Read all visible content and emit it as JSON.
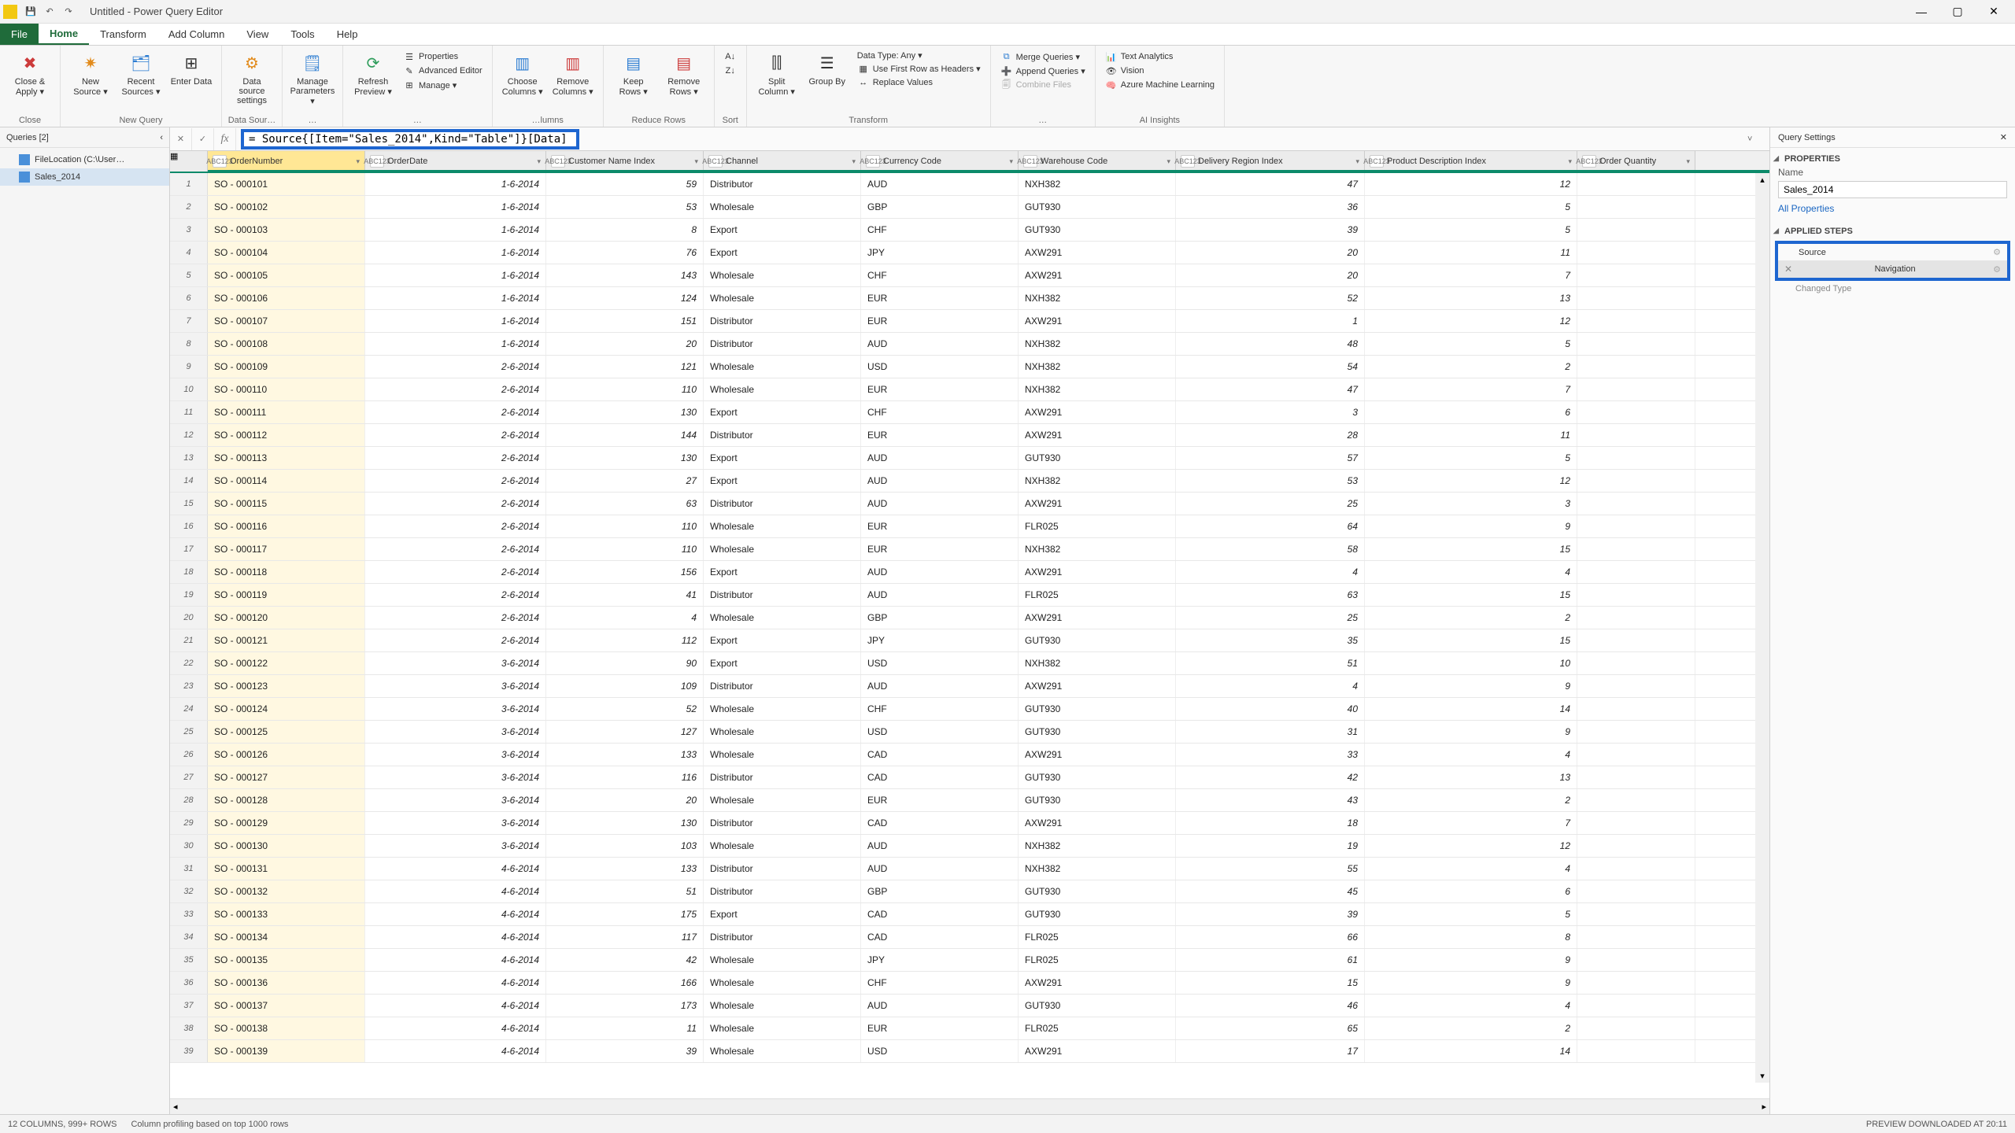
{
  "window": {
    "title": "Untitled - Power Query Editor"
  },
  "menus": {
    "file": "File",
    "home": "Home",
    "transform": "Transform",
    "addcol": "Add Column",
    "view": "View",
    "tools": "Tools",
    "help": "Help"
  },
  "ribbon": {
    "close_apply": "Close &\nApply ▾",
    "close_lbl": "Close",
    "new_source": "New\nSource ▾",
    "recent_sources": "Recent\nSources ▾",
    "enter_data": "Enter\nData",
    "newquery_lbl": "New Query",
    "data_source": "Data source\nsettings",
    "datasource_lbl": "Data Sour…",
    "manage_params": "Manage\nParameters ▾",
    "params_lbl": "…",
    "refresh": "Refresh\nPreview ▾",
    "properties": "Properties",
    "adv_editor": "Advanced Editor",
    "manage": "Manage ▾",
    "query_lbl": "…",
    "choose_cols": "Choose\nColumns ▾",
    "remove_cols": "Remove\nColumns ▾",
    "cols_lbl": "…lumns",
    "keep_rows": "Keep\nRows ▾",
    "remove_rows": "Remove\nRows ▾",
    "rows_lbl": "Reduce Rows",
    "sort_lbl": "Sort",
    "split_col": "Split\nColumn ▾",
    "group_by": "Group\nBy",
    "datatype": "Data Type: Any ▾",
    "first_row": "Use First Row as Headers ▾",
    "replace": "Replace Values",
    "transform_lbl": "Transform",
    "merge": "Merge Queries ▾",
    "append": "Append Queries ▾",
    "combine_files": "Combine Files",
    "combine_lbl": "…",
    "text_analytics": "Text Analytics",
    "vision": "Vision",
    "azure_ml": "Azure Machine Learning",
    "ai_lbl": "AI Insights"
  },
  "formula": "= Source{[Item=\"Sales_2014\",Kind=\"Table\"]}[Data]",
  "queries": {
    "header": "Queries [2]",
    "items": [
      "FileLocation (C:\\User…",
      "Sales_2014"
    ],
    "selected": 1
  },
  "columns": [
    {
      "name": "OrderNumber",
      "type": "ABC123"
    },
    {
      "name": "OrderDate",
      "type": "ABC123"
    },
    {
      "name": "Customer Name Index",
      "type": "ABC123"
    },
    {
      "name": "Channel",
      "type": "ABC123"
    },
    {
      "name": "Currency Code",
      "type": "ABC123"
    },
    {
      "name": "Warehouse Code",
      "type": "ABC123"
    },
    {
      "name": "Delivery Region Index",
      "type": "ABC123"
    },
    {
      "name": "Product Description Index",
      "type": "ABC123"
    },
    {
      "name": "Order Quantity",
      "type": "ABC123"
    }
  ],
  "rows": [
    [
      "SO - 000101",
      "1-6-2014",
      "59",
      "Distributor",
      "AUD",
      "NXH382",
      "47",
      "12",
      ""
    ],
    [
      "SO - 000102",
      "1-6-2014",
      "53",
      "Wholesale",
      "GBP",
      "GUT930",
      "36",
      "5",
      ""
    ],
    [
      "SO - 000103",
      "1-6-2014",
      "8",
      "Export",
      "CHF",
      "GUT930",
      "39",
      "5",
      ""
    ],
    [
      "SO - 000104",
      "1-6-2014",
      "76",
      "Export",
      "JPY",
      "AXW291",
      "20",
      "11",
      ""
    ],
    [
      "SO - 000105",
      "1-6-2014",
      "143",
      "Wholesale",
      "CHF",
      "AXW291",
      "20",
      "7",
      ""
    ],
    [
      "SO - 000106",
      "1-6-2014",
      "124",
      "Wholesale",
      "EUR",
      "NXH382",
      "52",
      "13",
      ""
    ],
    [
      "SO - 000107",
      "1-6-2014",
      "151",
      "Distributor",
      "EUR",
      "AXW291",
      "1",
      "12",
      ""
    ],
    [
      "SO - 000108",
      "1-6-2014",
      "20",
      "Distributor",
      "AUD",
      "NXH382",
      "48",
      "5",
      ""
    ],
    [
      "SO - 000109",
      "2-6-2014",
      "121",
      "Wholesale",
      "USD",
      "NXH382",
      "54",
      "2",
      ""
    ],
    [
      "SO - 000110",
      "2-6-2014",
      "110",
      "Wholesale",
      "EUR",
      "NXH382",
      "47",
      "7",
      ""
    ],
    [
      "SO - 000111",
      "2-6-2014",
      "130",
      "Export",
      "CHF",
      "AXW291",
      "3",
      "6",
      ""
    ],
    [
      "SO - 000112",
      "2-6-2014",
      "144",
      "Distributor",
      "EUR",
      "AXW291",
      "28",
      "11",
      ""
    ],
    [
      "SO - 000113",
      "2-6-2014",
      "130",
      "Export",
      "AUD",
      "GUT930",
      "57",
      "5",
      ""
    ],
    [
      "SO - 000114",
      "2-6-2014",
      "27",
      "Export",
      "AUD",
      "NXH382",
      "53",
      "12",
      ""
    ],
    [
      "SO - 000115",
      "2-6-2014",
      "63",
      "Distributor",
      "AUD",
      "AXW291",
      "25",
      "3",
      ""
    ],
    [
      "SO - 000116",
      "2-6-2014",
      "110",
      "Wholesale",
      "EUR",
      "FLR025",
      "64",
      "9",
      ""
    ],
    [
      "SO - 000117",
      "2-6-2014",
      "110",
      "Wholesale",
      "EUR",
      "NXH382",
      "58",
      "15",
      ""
    ],
    [
      "SO - 000118",
      "2-6-2014",
      "156",
      "Export",
      "AUD",
      "AXW291",
      "4",
      "4",
      ""
    ],
    [
      "SO - 000119",
      "2-6-2014",
      "41",
      "Distributor",
      "AUD",
      "FLR025",
      "63",
      "15",
      ""
    ],
    [
      "SO - 000120",
      "2-6-2014",
      "4",
      "Wholesale",
      "GBP",
      "AXW291",
      "25",
      "2",
      ""
    ],
    [
      "SO - 000121",
      "2-6-2014",
      "112",
      "Export",
      "JPY",
      "GUT930",
      "35",
      "15",
      ""
    ],
    [
      "SO - 000122",
      "3-6-2014",
      "90",
      "Export",
      "USD",
      "NXH382",
      "51",
      "10",
      ""
    ],
    [
      "SO - 000123",
      "3-6-2014",
      "109",
      "Distributor",
      "AUD",
      "AXW291",
      "4",
      "9",
      ""
    ],
    [
      "SO - 000124",
      "3-6-2014",
      "52",
      "Wholesale",
      "CHF",
      "GUT930",
      "40",
      "14",
      ""
    ],
    [
      "SO - 000125",
      "3-6-2014",
      "127",
      "Wholesale",
      "USD",
      "GUT930",
      "31",
      "9",
      ""
    ],
    [
      "SO - 000126",
      "3-6-2014",
      "133",
      "Wholesale",
      "CAD",
      "AXW291",
      "33",
      "4",
      ""
    ],
    [
      "SO - 000127",
      "3-6-2014",
      "116",
      "Distributor",
      "CAD",
      "GUT930",
      "42",
      "13",
      ""
    ],
    [
      "SO - 000128",
      "3-6-2014",
      "20",
      "Wholesale",
      "EUR",
      "GUT930",
      "43",
      "2",
      ""
    ],
    [
      "SO - 000129",
      "3-6-2014",
      "130",
      "Distributor",
      "CAD",
      "AXW291",
      "18",
      "7",
      ""
    ],
    [
      "SO - 000130",
      "3-6-2014",
      "103",
      "Wholesale",
      "AUD",
      "NXH382",
      "19",
      "12",
      ""
    ],
    [
      "SO - 000131",
      "4-6-2014",
      "133",
      "Distributor",
      "AUD",
      "NXH382",
      "55",
      "4",
      ""
    ],
    [
      "SO - 000132",
      "4-6-2014",
      "51",
      "Distributor",
      "GBP",
      "GUT930",
      "45",
      "6",
      ""
    ],
    [
      "SO - 000133",
      "4-6-2014",
      "175",
      "Export",
      "CAD",
      "GUT930",
      "39",
      "5",
      ""
    ],
    [
      "SO - 000134",
      "4-6-2014",
      "117",
      "Distributor",
      "CAD",
      "FLR025",
      "66",
      "8",
      ""
    ],
    [
      "SO - 000135",
      "4-6-2014",
      "42",
      "Wholesale",
      "JPY",
      "FLR025",
      "61",
      "9",
      ""
    ],
    [
      "SO - 000136",
      "4-6-2014",
      "166",
      "Wholesale",
      "CHF",
      "AXW291",
      "15",
      "9",
      ""
    ],
    [
      "SO - 000137",
      "4-6-2014",
      "173",
      "Wholesale",
      "AUD",
      "GUT930",
      "46",
      "4",
      ""
    ],
    [
      "SO - 000138",
      "4-6-2014",
      "11",
      "Wholesale",
      "EUR",
      "FLR025",
      "65",
      "2",
      ""
    ],
    [
      "SO - 000139",
      "4-6-2014",
      "39",
      "Wholesale",
      "USD",
      "AXW291",
      "17",
      "14",
      ""
    ]
  ],
  "settings": {
    "header": "Query Settings",
    "properties": "PROPERTIES",
    "name_label": "Name",
    "name_value": "Sales_2014",
    "all_props": "All Properties",
    "applied": "APPLIED STEPS",
    "steps": [
      "Source",
      "Navigation",
      "Changed Type"
    ],
    "selected_step": 1
  },
  "status": {
    "left1": "12 COLUMNS, 999+ ROWS",
    "left2": "Column profiling based on top 1000 rows",
    "right": "PREVIEW DOWNLOADED AT 20:11"
  }
}
